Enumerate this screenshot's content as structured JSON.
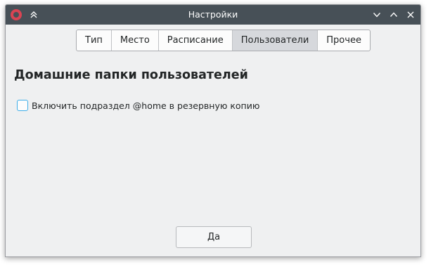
{
  "window": {
    "title": "Настройки"
  },
  "tabs": [
    {
      "label": "Тип",
      "active": false
    },
    {
      "label": "Место",
      "active": false
    },
    {
      "label": "Расписание",
      "active": false
    },
    {
      "label": "Пользователи",
      "active": true
    },
    {
      "label": "Прочее",
      "active": false
    }
  ],
  "section": {
    "heading": "Домашние папки пользователей",
    "checkbox_label": "Включить подраздел @home в резервную копию",
    "checkbox_checked": false
  },
  "footer": {
    "ok_label": "Да"
  },
  "icons": {
    "app": "app-logo-icon",
    "keep_above": "keep-above-icon",
    "minimize": "chevron-down-icon",
    "maximize": "chevron-up-icon",
    "close": "close-icon"
  },
  "colors": {
    "titlebar": "#475057",
    "window_bg": "#eff0f1",
    "checkbox_accent": "#3daee9",
    "active_tab": "#d6d8dc"
  }
}
